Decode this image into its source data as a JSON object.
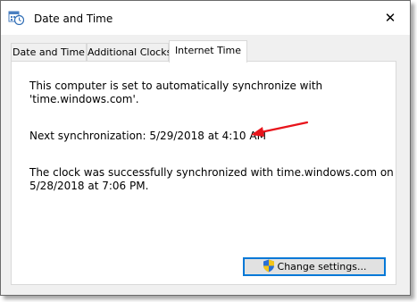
{
  "window": {
    "title": "Date and Time",
    "close_glyph": "✕"
  },
  "tabs": [
    {
      "label": "Date and Time",
      "selected": false
    },
    {
      "label": "Additional Clocks",
      "selected": false
    },
    {
      "label": "Internet Time",
      "selected": true
    }
  ],
  "panel": {
    "sync_line1": "This computer is set to automatically synchronize with",
    "sync_line2": "'time.windows.com'.",
    "next_sync": "Next synchronization: 5/29/2018 at 4:10 AM",
    "status_line1": "The clock was successfully synchronized with time.windows.com on",
    "status_line2": "5/28/2018 at 7:06 PM.",
    "change_button": "Change settings..."
  },
  "icons": {
    "app": "date-time-icon",
    "close": "close-icon",
    "shield": "uac-shield-icon",
    "annotation": "red-arrow-icon"
  },
  "colors": {
    "accent": "#0078d7",
    "annotation_arrow": "#e8141b"
  }
}
